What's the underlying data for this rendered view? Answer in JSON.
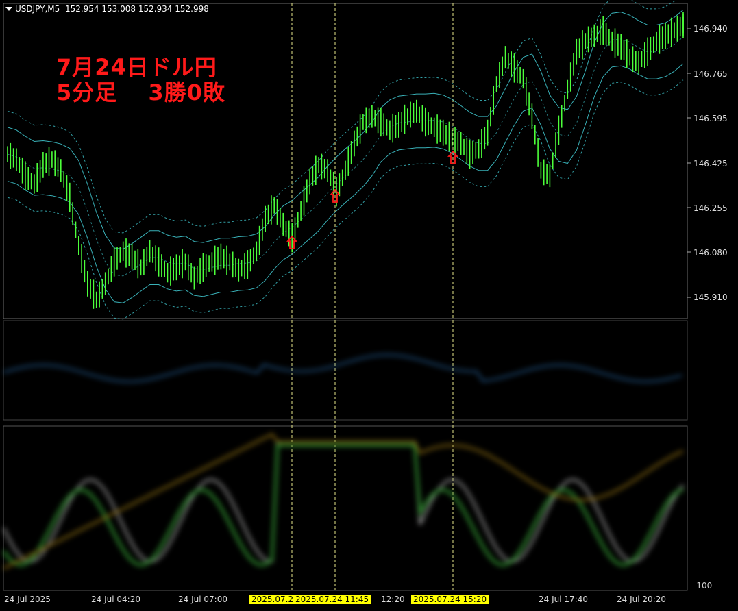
{
  "header": {
    "symbol": "USDJPY,M5",
    "ohlc": "152.954 153.008 152.934 152.998"
  },
  "annotation": {
    "line1": "7月24日ドル円",
    "line2": "5分足　 3勝0敗"
  },
  "price_axis": [
    "146.940",
    "146.765",
    "146.595",
    "146.425",
    "146.255",
    "146.080",
    "145.910"
  ],
  "indicator_axis": {
    "bottom_label": "-100"
  },
  "time_axis": [
    {
      "label": "24 Jul 2025",
      "highlight": false
    },
    {
      "label": "24 Jul 04:20",
      "highlight": false
    },
    {
      "label": "24 Jul 07:00",
      "highlight": false
    },
    {
      "label": "2025.07.2",
      "highlight": true
    },
    {
      "label": "2025.07.24 11:45",
      "highlight": true
    },
    {
      "label": "12:20",
      "highlight": false
    },
    {
      "label": "2025.07.24 15:20",
      "highlight": true
    },
    {
      "label": "24 Jul 17:40",
      "highlight": false
    },
    {
      "label": "24 Jul 20:20",
      "highlight": false
    }
  ],
  "signals": [
    {
      "type": "buy-arrow"
    },
    {
      "type": "buy-arrow"
    },
    {
      "type": "buy-arrow"
    }
  ],
  "colors": {
    "background": "#000000",
    "candle": "#4cff3a",
    "band": "#3fc4cc",
    "signal": "#ff1a1a",
    "vline": "#e6e68a",
    "highlight": "#ffff00"
  },
  "chart_data": {
    "type": "line",
    "series": [
      {
        "values": [
          146.46,
          146.44,
          146.38,
          146.35,
          146.42,
          146.44,
          146.4,
          146.3,
          146.12,
          145.98,
          145.92,
          145.98,
          146.06,
          146.1,
          146.08,
          146.04,
          146.1,
          146.06,
          146.02,
          146.04,
          146.06,
          146.0,
          146.04,
          146.06,
          146.08,
          146.06,
          146.03,
          146.05,
          146.1,
          146.22,
          146.27,
          146.2,
          146.15,
          146.25,
          146.36,
          146.42,
          146.4,
          146.32,
          146.4,
          146.5,
          146.58,
          146.6,
          146.58,
          146.55,
          146.57,
          146.6,
          146.62,
          146.58,
          146.56,
          146.54,
          146.52,
          146.5,
          146.46,
          146.48,
          146.54,
          146.72,
          146.82,
          146.78,
          146.74,
          146.6,
          146.4,
          146.38,
          146.55,
          146.7,
          146.84,
          146.88,
          146.9,
          146.92,
          146.88,
          146.86,
          146.82,
          146.8,
          146.84,
          146.88,
          146.9,
          146.92,
          146.94
        ]
      }
    ],
    "ylim": [
      145.85,
      147.02
    ]
  }
}
